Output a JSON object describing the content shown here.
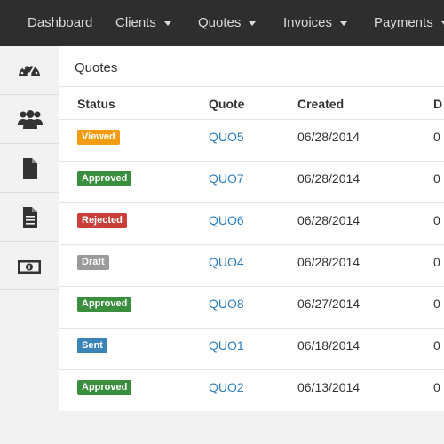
{
  "nav": {
    "items": [
      {
        "label": "Dashboard",
        "dropdown": false
      },
      {
        "label": "Clients",
        "dropdown": true
      },
      {
        "label": "Quotes",
        "dropdown": true
      },
      {
        "label": "Invoices",
        "dropdown": true
      },
      {
        "label": "Payments",
        "dropdown": true
      }
    ]
  },
  "sidebar": {
    "icons": [
      "dashboard-gauge-icon",
      "clients-group-icon",
      "quote-file-icon",
      "invoice-file-icon",
      "payment-money-icon"
    ]
  },
  "main": {
    "title": "Quotes",
    "columns": [
      "Status",
      "Quote",
      "Created",
      "D"
    ],
    "rows": [
      {
        "status": "Viewed",
        "status_color": "#f39c12",
        "quote": "QUO5",
        "created": "06/28/2014",
        "due_partial": "0"
      },
      {
        "status": "Approved",
        "status_color": "#3a8e3d",
        "quote": "QUO7",
        "created": "06/28/2014",
        "due_partial": "0"
      },
      {
        "status": "Rejected",
        "status_color": "#c9403a",
        "quote": "QUO6",
        "created": "06/28/2014",
        "due_partial": "0"
      },
      {
        "status": "Draft",
        "status_color": "#9a9a9a",
        "quote": "QUO4",
        "created": "06/28/2014",
        "due_partial": "0"
      },
      {
        "status": "Approved",
        "status_color": "#3a8e3d",
        "quote": "QUO8",
        "created": "06/27/2014",
        "due_partial": "0"
      },
      {
        "status": "Sent",
        "status_color": "#3a84b8",
        "quote": "QUO1",
        "created": "06/18/2014",
        "due_partial": "0"
      },
      {
        "status": "Approved",
        "status_color": "#3a8e3d",
        "quote": "QUO2",
        "created": "06/13/2014",
        "due_partial": "0"
      }
    ]
  }
}
